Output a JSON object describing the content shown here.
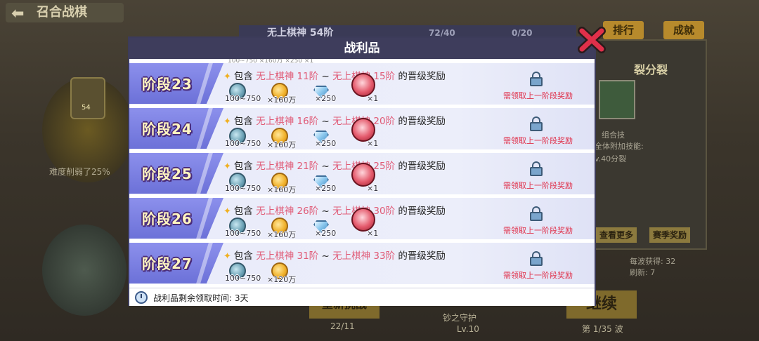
{
  "background": {
    "back_title": "召合战棋",
    "center_tab": "无上棋神 54阶",
    "counter1": "72/40",
    "counter2": "0/20",
    "rank_button": "排行",
    "achievement_button": "成就",
    "right_panel_title": "裂分裂",
    "right_panel_line1": "组合技",
    "right_panel_line2": "全体附加技能:",
    "right_panel_line3": "v.40分裂",
    "view_more_button": "查看更多",
    "season_reward_button": "赛季奖励",
    "stat1": "每波获得: 32",
    "stat2": "刷新: 7",
    "left_badge": "54",
    "difficulty_text": "难度削弱了25%",
    "bottom_counter": "22/11",
    "bottom_label": "钞之守护",
    "bottom_level": "Lv.10",
    "continue_button": "继续",
    "wave_text": "第 1/35 波",
    "restart_button": "重新挑战"
  },
  "modal": {
    "title": "战利品",
    "peek_text": "100~750 ×160万 ×250 ×1",
    "rows": [
      {
        "stage": "阶段23",
        "prefix": "包含",
        "from": "无上棋神 11阶",
        "sep": "~",
        "to": "无上棋神 15阶",
        "suffix": "的晋级奖励",
        "exp": "100~750",
        "coin": "×160万",
        "gem": "×250",
        "egg": "×1",
        "lock_note": "需领取上一阶段奖励"
      },
      {
        "stage": "阶段24",
        "prefix": "包含",
        "from": "无上棋神 16阶",
        "sep": "~",
        "to": "无上棋神 20阶",
        "suffix": "的晋级奖励",
        "exp": "100~750",
        "coin": "×160万",
        "gem": "×250",
        "egg": "×1",
        "lock_note": "需领取上一阶段奖励"
      },
      {
        "stage": "阶段25",
        "prefix": "包含",
        "from": "无上棋神 21阶",
        "sep": "~",
        "to": "无上棋神 25阶",
        "suffix": "的晋级奖励",
        "exp": "100~750",
        "coin": "×160万",
        "gem": "×250",
        "egg": "×1",
        "lock_note": "需领取上一阶段奖励"
      },
      {
        "stage": "阶段26",
        "prefix": "包含",
        "from": "无上棋神 26阶",
        "sep": "~",
        "to": "无上棋神 30阶",
        "suffix": "的晋级奖励",
        "exp": "100~750",
        "coin": "×160万",
        "gem": "×250",
        "egg": "×1",
        "lock_note": "需领取上一阶段奖励"
      },
      {
        "stage": "阶段27",
        "prefix": "包含",
        "from": "无上棋神 31阶",
        "sep": "~",
        "to": "无上棋神 33阶",
        "suffix": "的晋级奖励",
        "exp": "100~750",
        "coin": "×120万",
        "lock_note": "需领取上一阶段奖励"
      }
    ],
    "footer_text": "战利品剩余领取时间: 3天"
  },
  "colors": {
    "header_bg": "#3e3d5c",
    "stage_bg": "#7a7fe0",
    "highlight_text": "#e05a76",
    "lock_note": "#e0304a",
    "close_x": "#e0304a"
  },
  "icons": {
    "close": "close-x-icon",
    "exp": "exp-orb-icon",
    "coin": "gold-coin-icon",
    "gem": "diamond-icon",
    "egg": "red-egg-icon",
    "lock": "lock-icon",
    "clock": "clock-icon",
    "star": "star-icon"
  }
}
